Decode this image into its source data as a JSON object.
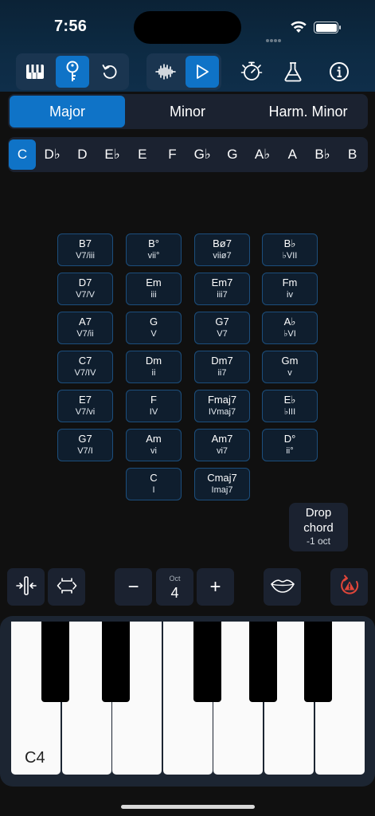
{
  "status": {
    "time": "7:56"
  },
  "toolbar": {
    "buttons": [
      {
        "id": "piano",
        "icon": "piano-icon",
        "active": false
      },
      {
        "id": "key",
        "icon": "key-icon",
        "active": true
      },
      {
        "id": "undo",
        "icon": "undo-icon",
        "active": false
      },
      {
        "id": "waveform",
        "icon": "waveform-icon",
        "active": false
      },
      {
        "id": "play",
        "icon": "play-icon",
        "active": true
      },
      {
        "id": "metronome",
        "icon": "timer-icon",
        "active": false
      },
      {
        "id": "lab",
        "icon": "flask-icon",
        "active": false
      },
      {
        "id": "info",
        "icon": "info-icon",
        "active": false
      }
    ]
  },
  "scale_tabs": [
    "Major",
    "Minor",
    "Harm. Minor"
  ],
  "selected_scale": "Major",
  "keys": [
    "C",
    "D♭",
    "D",
    "E♭",
    "E",
    "F",
    "G♭",
    "G",
    "A♭",
    "A",
    "B♭",
    "B"
  ],
  "selected_key": "C",
  "chords": [
    [
      {
        "name": "B7",
        "roman": "V7/iii"
      },
      {
        "name": "B°",
        "roman": "vii°"
      },
      {
        "name": "Bø7",
        "roman": "viiø7"
      },
      {
        "name": "B♭",
        "roman": "♭VII"
      }
    ],
    [
      {
        "name": "D7",
        "roman": "V7/V"
      },
      {
        "name": "Em",
        "roman": "iii"
      },
      {
        "name": "Em7",
        "roman": "iii7"
      },
      {
        "name": "Fm",
        "roman": "iv"
      }
    ],
    [
      {
        "name": "A7",
        "roman": "V7/ii"
      },
      {
        "name": "G",
        "roman": "V"
      },
      {
        "name": "G7",
        "roman": "V7"
      },
      {
        "name": "A♭",
        "roman": "♭VI"
      }
    ],
    [
      {
        "name": "C7",
        "roman": "V7/IV"
      },
      {
        "name": "Dm",
        "roman": "ii"
      },
      {
        "name": "Dm7",
        "roman": "ii7"
      },
      {
        "name": "Gm",
        "roman": "v"
      }
    ],
    [
      {
        "name": "E7",
        "roman": "V7/vi"
      },
      {
        "name": "F",
        "roman": "IV"
      },
      {
        "name": "Fmaj7",
        "roman": "IVmaj7"
      },
      {
        "name": "E♭",
        "roman": "♭III"
      }
    ],
    [
      {
        "name": "G7",
        "roman": "V7/I"
      },
      {
        "name": "Am",
        "roman": "vi"
      },
      {
        "name": "Am7",
        "roman": "vi7"
      },
      {
        "name": "D°",
        "roman": "ii°"
      }
    ],
    [
      null,
      {
        "name": "C",
        "roman": "I"
      },
      {
        "name": "Cmaj7",
        "roman": "Imaj7"
      },
      null
    ]
  ],
  "drop_chord": {
    "line1": "Drop",
    "line2": "chord",
    "line3": "-1 oct"
  },
  "controls": {
    "octave_label": "Oct",
    "octave_value": "4",
    "minus": "−",
    "plus": "+"
  },
  "piano": {
    "start_label": "C4"
  },
  "colors": {
    "accent": "#0f73c7",
    "warning": "#e0463a"
  }
}
